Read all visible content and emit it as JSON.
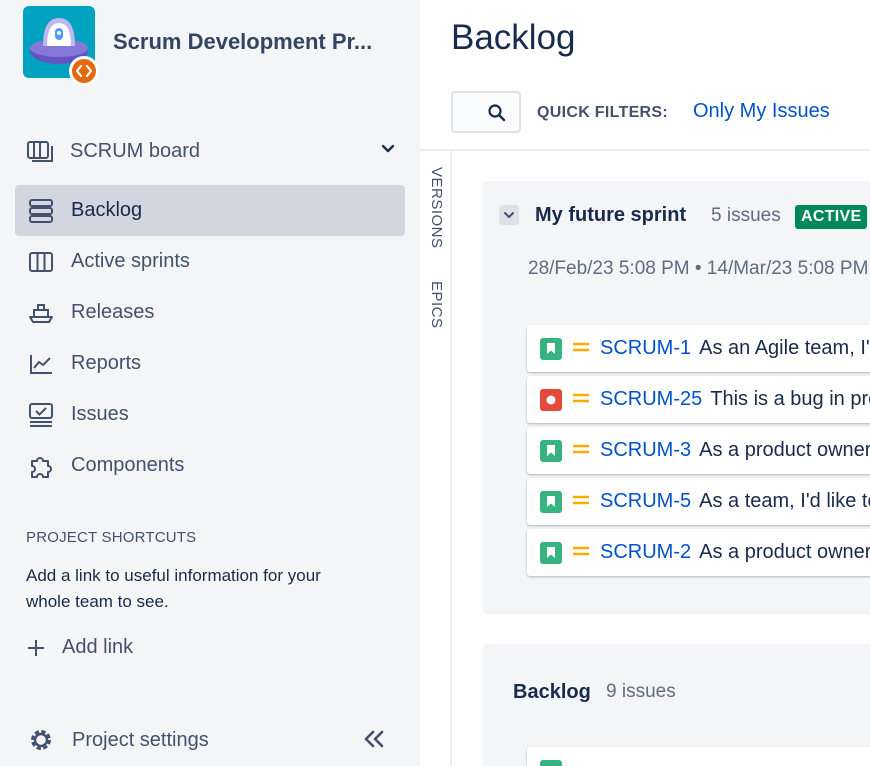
{
  "project": {
    "name": "Scrum Development Pr...",
    "avatar_icon": "ufo-icon",
    "badge_icon": "code-brackets-icon",
    "avatar_color": "#00a3bf",
    "badge_color": "#e56910"
  },
  "sidebar": {
    "board_switcher": {
      "label": "SCRUM board",
      "icon": "board-icon"
    },
    "items": [
      {
        "label": "Backlog",
        "icon": "backlog-icon",
        "active": true
      },
      {
        "label": "Active sprints",
        "icon": "columns-icon",
        "active": false
      },
      {
        "label": "Releases",
        "icon": "ship-icon",
        "active": false
      },
      {
        "label": "Reports",
        "icon": "graph-line-icon",
        "active": false
      },
      {
        "label": "Issues",
        "icon": "issues-icon",
        "active": false
      },
      {
        "label": "Components",
        "icon": "puzzle-icon",
        "active": false
      }
    ],
    "shortcuts": {
      "heading": "PROJECT SHORTCUTS",
      "description": "Add a link to useful information for your whole team to see.",
      "add_link_label": "Add link"
    },
    "settings_label": "Project settings"
  },
  "main": {
    "title": "Backlog",
    "quick_filters_label": "QUICK FILTERS:",
    "quick_filter_link": "Only My Issues",
    "side_tabs": [
      "VERSIONS",
      "EPICS"
    ],
    "sprint": {
      "name": "My future sprint",
      "count": "5 issues",
      "status": "ACTIVE",
      "dates": "28/Feb/23 5:08 PM  •  14/Mar/23 5:08 PM",
      "issues": [
        {
          "key": "SCRUM-1",
          "summary": "As an Agile team, I'd like to learn about Scrum",
          "type": "story",
          "priority": "medium"
        },
        {
          "key": "SCRUM-25",
          "summary": "This is a bug in production",
          "type": "bug",
          "priority": "medium"
        },
        {
          "key": "SCRUM-3",
          "summary": "As a product owner, I'd like to express work",
          "type": "story",
          "priority": "medium"
        },
        {
          "key": "SCRUM-5",
          "summary": "As a team, I'd like to estimate the effort",
          "type": "story",
          "priority": "medium"
        },
        {
          "key": "SCRUM-2",
          "summary": "As a product owner, I'd like to rank stories",
          "type": "story",
          "priority": "medium"
        }
      ]
    },
    "backlog": {
      "name": "Backlog",
      "count": "9 issues"
    }
  },
  "colors": {
    "story": "#36b37e",
    "bug": "#e5493a",
    "priority_medium": "#ffab00",
    "link": "#0052cc",
    "active_badge": "#00875a"
  }
}
